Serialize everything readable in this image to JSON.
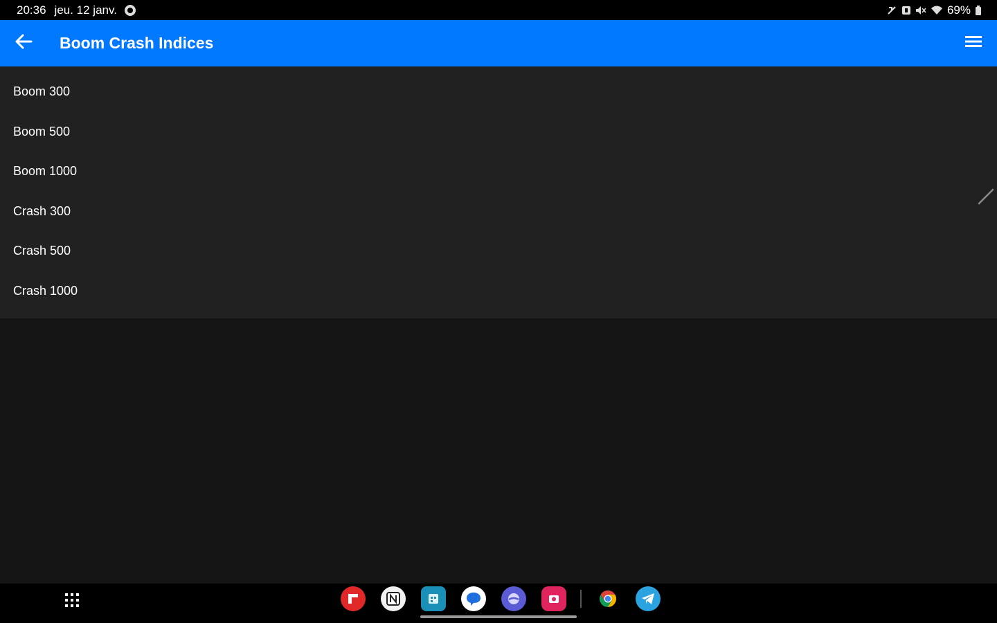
{
  "status_bar": {
    "time": "20:36",
    "date": "jeu. 12 janv.",
    "battery": "69%",
    "icons": [
      "notification-dot-icon",
      "mute-icon",
      "alarm-icon",
      "volume-off-icon",
      "wifi-icon",
      "battery-icon"
    ]
  },
  "app_bar": {
    "title": "Boom Crash Indices",
    "color": "#0078ff",
    "back_icon": "arrow-left-icon",
    "menu_icon": "hamburger-menu-icon"
  },
  "list": {
    "items": [
      {
        "label": "Boom 300"
      },
      {
        "label": "Boom 500"
      },
      {
        "label": "Boom 1000"
      },
      {
        "label": "Crash 300"
      },
      {
        "label": "Crash 500"
      },
      {
        "label": "Crash 1000"
      }
    ]
  },
  "taskbar": {
    "apps_icon": "apps-grid-icon",
    "dock": [
      {
        "name": "flipboard-icon",
        "color": "#e12828"
      },
      {
        "name": "notion-icon",
        "color": "#ffffff"
      },
      {
        "name": "calendar-icon",
        "color": "#1a8fb8"
      },
      {
        "name": "messages-icon",
        "color": "#1f6fe0"
      },
      {
        "name": "internet-browser-icon",
        "color": "#5b5bd6"
      },
      {
        "name": "screen-recorder-icon",
        "color": "#e0245e"
      },
      {
        "name": "chrome-icon",
        "color": "#f0b400"
      },
      {
        "name": "telegram-icon",
        "color": "#2aa3e0"
      }
    ]
  }
}
